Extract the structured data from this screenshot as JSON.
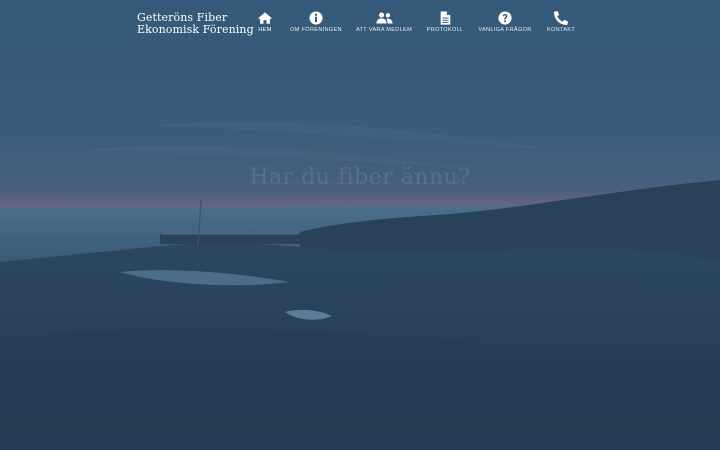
{
  "brand": {
    "line1": "Getteröns Fiber",
    "line2": "Ekonomisk Förening"
  },
  "nav": {
    "items": [
      {
        "label": "HEM",
        "icon": "home-icon",
        "active": true
      },
      {
        "label": "OM FÖRENINGEN",
        "icon": "info-icon",
        "active": false
      },
      {
        "label": "ATT VARA MEDLEM",
        "icon": "users-icon",
        "active": false
      },
      {
        "label": "PROTOKOLL",
        "icon": "document-icon",
        "active": false
      },
      {
        "label": "VANLIGA FRÅGOR",
        "icon": "question-icon",
        "active": false
      },
      {
        "label": "KONTAKT",
        "icon": "phone-icon",
        "active": false
      }
    ]
  },
  "hero": {
    "headline": "Har du fiber ännu?"
  },
  "colors": {
    "overlay": "#2d4a63",
    "text": "#ffffff"
  }
}
